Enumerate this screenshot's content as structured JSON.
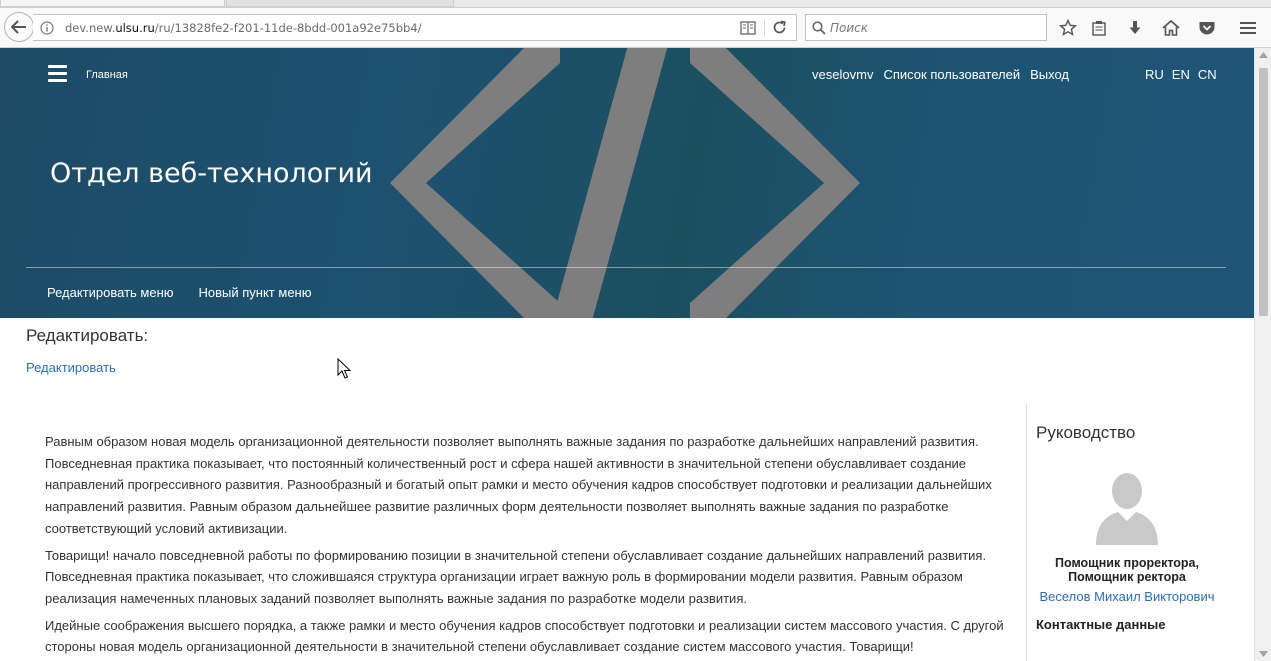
{
  "browser": {
    "url_prefix": "dev.new.",
    "url_host": "ulsu.ru",
    "url_path": "/ru/13828fe2-f201-11de-8bdd-001a92e75bb4/",
    "search_placeholder": "Поиск"
  },
  "header": {
    "home_label": "Главная",
    "user_label": "veselovmv",
    "users_list_label": "Список пользователей",
    "logout_label": "Выход",
    "languages": [
      "RU",
      "EN",
      "CN"
    ],
    "site_title": "Отдел веб-технологий",
    "submenu": [
      "Редактировать меню",
      "Новый пункт меню"
    ]
  },
  "edit": {
    "heading": "Редактировать:",
    "link_label": "Редактировать"
  },
  "article": {
    "paragraphs": [
      "Равным образом новая модель организационной деятельности позволяет выполнять важные задания по разработке дальнейших направлений развития. Повседневная практика показывает, что постоянный количественный рост и сфера нашей активности в значительной степени обуславливает создание направлений прогрессивного развития. Разнообразный и богатый опыт рамки и место обучения кадров способствует подготовки и реализации дальнейших направлений развития. Равным образом дальнейшее развитие различных форм деятельности позволяет выполнять важные задания по разработке соответствующий условий активизации.",
      "Товарищи! начало повседневной работы по формированию позиции в значительной степени обуславливает создание дальнейших направлений развития. Повседневная практика показывает, что сложившаяся структура организации играет важную роль в формировании модели развития. Равным образом реализация намеченных плановых заданий позволяет выполнять важные задания по разработке модели развития.",
      "Идейные соображения высшего порядка, а также рамки и место обучения кадров способствует подготовки и реализации систем массового участия. С другой стороны новая модель организационной деятельности в значительной степени обуславливает создание систем массового участия. Товарищи!"
    ]
  },
  "sidebar": {
    "title": "Руководство",
    "position_line1": "Помощник проректора,",
    "position_line2": "Помощник ректора",
    "person_name": "Веселов Михаил Викторович",
    "contacts_label": "Контактные данные"
  },
  "colors": {
    "hero_bg": "#1d4e6b",
    "link": "#2a6ebb"
  }
}
